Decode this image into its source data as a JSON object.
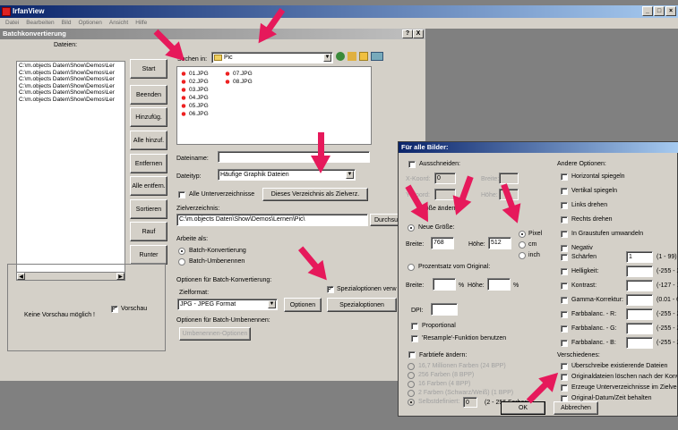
{
  "app": {
    "title": "IrfanView",
    "menu": [
      "Datei",
      "Bearbeiten",
      "Bild",
      "Optionen",
      "Ansicht",
      "Hilfe"
    ]
  },
  "batch": {
    "title": "Batchkonvertierung",
    "help_btn": "?",
    "close_btn": "X",
    "files_label": "Dateien:",
    "file_list": [
      "C:\\m.objects Daten\\Show\\Demos\\Ler",
      "C:\\m.objects Daten\\Show\\Demos\\Ler",
      "C:\\m.objects Daten\\Show\\Demos\\Ler",
      "C:\\m.objects Daten\\Show\\Demos\\Ler",
      "C:\\m.objects Daten\\Show\\Demos\\Ler",
      "C:\\m.objects Daten\\Show\\Demos\\Ler"
    ],
    "buttons": {
      "start": "Start",
      "beenden": "Beenden",
      "hinzufueg": "Hinzufüg.",
      "alle_hinzu": "Alle hinzuf.",
      "entfernen": "Entfernen",
      "alle_entfernen": "Alle entfern.",
      "sortieren": "Sortieren",
      "rauf": "Rauf",
      "runter": "Runter"
    },
    "preview_text": "Keine Vorschau möglich !",
    "preview_checkbox": "Vorschau",
    "search_in_label": "Suchen in:",
    "search_in_value": "Pic",
    "files_col1": [
      "01.JPG",
      "02.JPG",
      "03.JPG",
      "04.JPG",
      "05.JPG",
      "06.JPG"
    ],
    "files_col2": [
      "07.JPG",
      "08.JPG"
    ],
    "dateiname_label": "Dateiname:",
    "dateityp_label": "Dateityp:",
    "dateityp_value": "Häufige Graphik Dateien",
    "alle_unterverz": "Alle Unterverzeichnisse",
    "add_dir_btn": "Dieses Verzeichnis als Zielverz.",
    "zielverz_label": "Zielverzeichnis:",
    "zielverz_value": "C:\\m.objects Daten\\Show\\Demos\\Lernen\\Pic\\",
    "durchsuchen": "Durchsu",
    "arbeite_als": "Arbeite als:",
    "opt_batch_konv": "Batch-Konvertierung",
    "opt_batch_umb": "Batch-Umbenennen",
    "opt_group_konv": "Optionen für Batch-Konvertierung:",
    "zielformat_label": "Zielformat:",
    "zielformat_value": "JPG - JPEG Format",
    "optionen_btn": "Optionen",
    "spezial_check": "Spezialoptionen verw",
    "spezial_btn": "Spezialoptionen",
    "opt_group_umb": "Optionen für Batch-Umbenennen:",
    "umb_btn": "Umbenennen-Optionen"
  },
  "dialog": {
    "title": "Für alle Bilder:",
    "ausschneiden": "Ausschneiden:",
    "xkoord": "X-Koord:",
    "xkoord_val": "0",
    "breite": "Breite:",
    "ykoord": "Y-Koord:",
    "hoehe": "Höhe:",
    "groesse_aendern": "Größe ändern:",
    "neue_groesse": "Neue Größe:",
    "breite2": "Breite:",
    "breite2_val": "768",
    "hoehe2": "Höhe:",
    "hoehe2_val": "512",
    "pixel": "Pixel",
    "cm": "cm",
    "inch": "inch",
    "prozentsatz": "Prozentsatz vom Original:",
    "breite3": "Breite:",
    "pct1": "%",
    "hoehe3": "Höhe:",
    "pct2": "%",
    "dpi": "DPI:",
    "proportional": "Proportional",
    "resample": "'Resample'-Funktion benutzen",
    "farbtiefe": "Farbtiefe ändern:",
    "farb_opts": [
      "16,7 Millionen Farben (24 BPP)",
      "256 Farben (8 BPP)",
      "16 Farben (4 BPP)",
      "2 Farben (Schwarz/Weiß) (1 BPP)",
      "Selbstdefiniert:"
    ],
    "farb_custom_val": "0",
    "farb_custom_hint": "(2 - 256 Farben)",
    "andere": "Andere Optionen:",
    "andere_items": [
      "Horizontal spiegeln",
      "Vertikal spiegeln",
      "Links drehen",
      "Rechts drehen",
      "In Graustufen umwandeln",
      "Negativ"
    ],
    "adjust_items": [
      {
        "label": "Schärfen",
        "value": "1",
        "range": "(1 - 99)"
      },
      {
        "label": "Helligkeit:",
        "value": "",
        "range": "(-255 - 2"
      },
      {
        "label": "Kontrast:",
        "value": "",
        "range": "(-127 - 1"
      },
      {
        "label": "Gamma-Korrektur:",
        "value": "",
        "range": "(0.01 - 6"
      },
      {
        "label": "Farbbalanc. - R:",
        "value": "",
        "range": "(-255 - 2"
      },
      {
        "label": "Farbbalanc. - G:",
        "value": "",
        "range": "(-255 - 2"
      },
      {
        "label": "Farbbalanc. - B:",
        "value": "",
        "range": "(-255 - 2"
      }
    ],
    "verschiedenes": "Verschiedenes:",
    "versch_items": [
      "Überschreibe existierende Dateien",
      "Originaldateien löschen nach der Konv",
      "Erzeuge Unterverzeichnisse im Zielverz",
      "Original-Datum/Zeit behalten"
    ],
    "ok": "OK",
    "abbrechen": "Abbrechen"
  },
  "colors": {
    "arrow": "#e6195b",
    "titlebar": "#0a246a",
    "face": "#d4d0c8"
  }
}
